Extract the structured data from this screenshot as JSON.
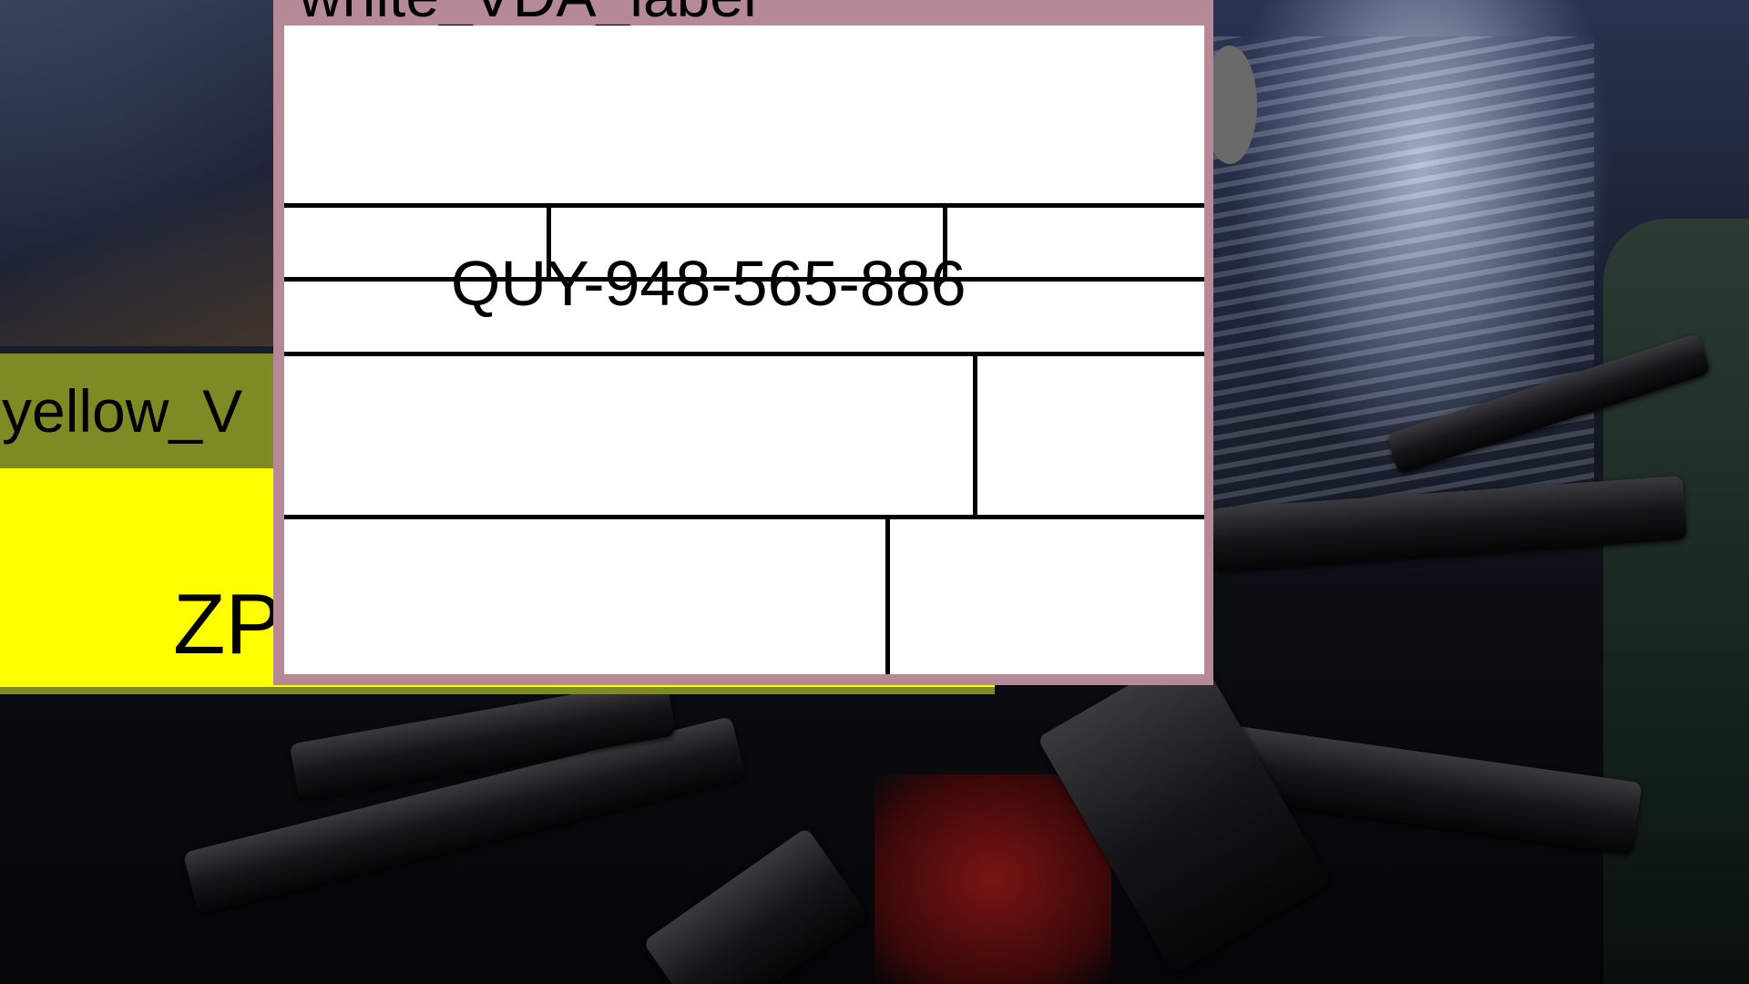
{
  "background": {
    "description_icon": "action-movie-poster-background"
  },
  "yellow_label": {
    "title": "yellow_V",
    "code": "ZP",
    "colors": {
      "header": "#7e8a24",
      "body": "#ffff00"
    }
  },
  "white_label": {
    "title": "white_VDA_label",
    "code": "QUY-948-565-886",
    "colors": {
      "frame": "#b58a96",
      "body": "#ffffff"
    }
  }
}
